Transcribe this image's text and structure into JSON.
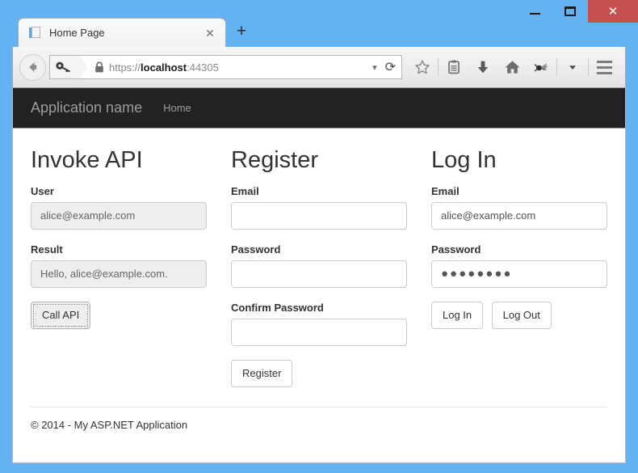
{
  "window": {
    "minimize_label": "Minimize",
    "maximize_label": "Maximize",
    "close_label": "✕"
  },
  "browser": {
    "tab": {
      "title": "Home Page",
      "close_label": "✕",
      "favicon": "page-icon"
    },
    "new_tab_label": "+",
    "back_label": "Back",
    "url": {
      "scheme": "https://",
      "host": "localhost",
      "port": ":44305",
      "full": "https://localhost:44305"
    },
    "url_dropmarker": "▾",
    "reload_label": "⟳",
    "toolbar_icons": [
      {
        "name": "bookmark-star-icon"
      },
      {
        "name": "reading-list-icon"
      },
      {
        "name": "downloads-icon"
      },
      {
        "name": "home-icon"
      },
      {
        "name": "extension-bug-icon"
      },
      {
        "name": "overflow-chevron-icon"
      }
    ],
    "menu_label": "Open menu"
  },
  "site": {
    "nav": {
      "brand": "Application name",
      "links": [
        {
          "label": "Home"
        }
      ]
    },
    "columns": [
      {
        "heading": "Invoke API",
        "fields": [
          {
            "label": "User",
            "value": "alice@example.com",
            "type": "text",
            "disabled": true
          },
          {
            "label": "Result",
            "value": "Hello, alice@example.com.",
            "type": "text",
            "disabled": true
          }
        ],
        "buttons": [
          {
            "label": "Call API",
            "state": "focused"
          }
        ]
      },
      {
        "heading": "Register",
        "fields": [
          {
            "label": "Email",
            "value": "",
            "type": "text",
            "disabled": false
          },
          {
            "label": "Password",
            "value": "",
            "type": "password",
            "disabled": false
          },
          {
            "label": "Confirm Password",
            "value": "",
            "type": "password",
            "disabled": false
          }
        ],
        "buttons": [
          {
            "label": "Register",
            "state": "normal"
          }
        ]
      },
      {
        "heading": "Log In",
        "fields": [
          {
            "label": "Email",
            "value": "alice@example.com",
            "type": "text",
            "disabled": false
          },
          {
            "label": "Password",
            "value": "●●●●●●●●",
            "type": "password",
            "disabled": false
          }
        ],
        "buttons": [
          {
            "label": "Log In",
            "state": "normal"
          },
          {
            "label": "Log Out",
            "state": "normal"
          }
        ]
      }
    ],
    "footer": "© 2014 - My ASP.NET Application"
  },
  "colors": {
    "window_frame": "#64b1f4",
    "close_button": "#c75050",
    "navbar_bg": "#222222",
    "navbar_text": "#9d9d9d",
    "input_border": "#cccccc",
    "disabled_input_bg": "#eeeeee"
  }
}
